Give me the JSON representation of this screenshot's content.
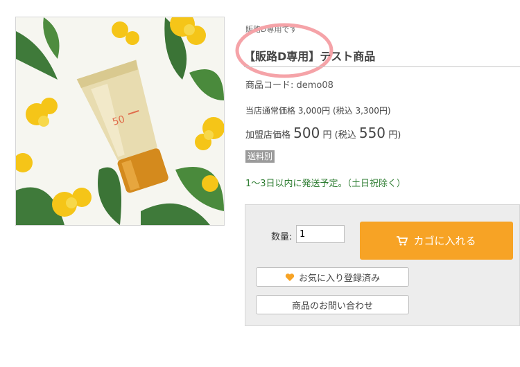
{
  "product": {
    "category": "販路D専用です",
    "title": "【販路D専用】テスト商品",
    "code": "商品コード: demo08",
    "regular_price": "当店通常価格 3,000円 (税込 3,300円)",
    "member_price": {
      "label": "加盟店価格",
      "price": "500",
      "unit": "円",
      "tax_prefix": "(税込",
      "tax_price": "550",
      "tax_suffix": "円)"
    },
    "shipping_badge": "送料別",
    "delivery": "1〜3日以内に発送予定。（土日祝除く）",
    "image_icon": "sunscreen-tube-photo"
  },
  "cart": {
    "qty_label": "数量:",
    "qty_value": "1",
    "add_to_cart": "カゴに入れる",
    "favorite": "お気に入り登録済み",
    "inquiry": "商品のお問い合わせ"
  },
  "colors": {
    "accent": "#f7a325",
    "delivery_green": "#2e7d32",
    "badge_gray": "#9b9b9b",
    "annotation_pink": "#f5a3a8"
  }
}
